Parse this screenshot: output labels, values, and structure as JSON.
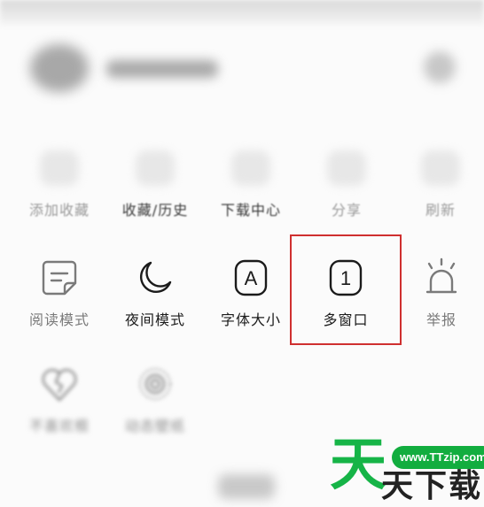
{
  "colors": {
    "text_primary": "#1b1b1b",
    "text_muted": "#8a8a8a",
    "highlight": "#cf2f2f",
    "watermark_green": "#16b447",
    "watermark_text": "#222222"
  },
  "menu": {
    "row1": [
      {
        "label": "添加收藏",
        "icon": "bookmark-add-icon"
      },
      {
        "label": "收藏/历史",
        "icon": "history-icon"
      },
      {
        "label": "下载中心",
        "icon": "download-icon"
      },
      {
        "label": "分享",
        "icon": "share-icon"
      },
      {
        "label": "刷新",
        "icon": "refresh-icon"
      }
    ],
    "row2": [
      {
        "label": "阅读模式",
        "icon": "reading-mode-icon"
      },
      {
        "label": "夜间模式",
        "icon": "moon-icon"
      },
      {
        "label": "字体大小",
        "icon": "font-size-icon",
        "glyph": "A"
      },
      {
        "label": "多窗口",
        "icon": "windows-icon",
        "glyph": "1"
      },
      {
        "label": "举报",
        "icon": "alarm-icon"
      }
    ],
    "row3": [
      {
        "label": "不喜欢根",
        "icon": "broken-heart-icon"
      },
      {
        "label": "动态壁纸",
        "icon": "wallpaper-icon"
      }
    ]
  },
  "watermark": {
    "brand_char": "天",
    "url": "www.TTzip.com",
    "text": "天下载"
  }
}
